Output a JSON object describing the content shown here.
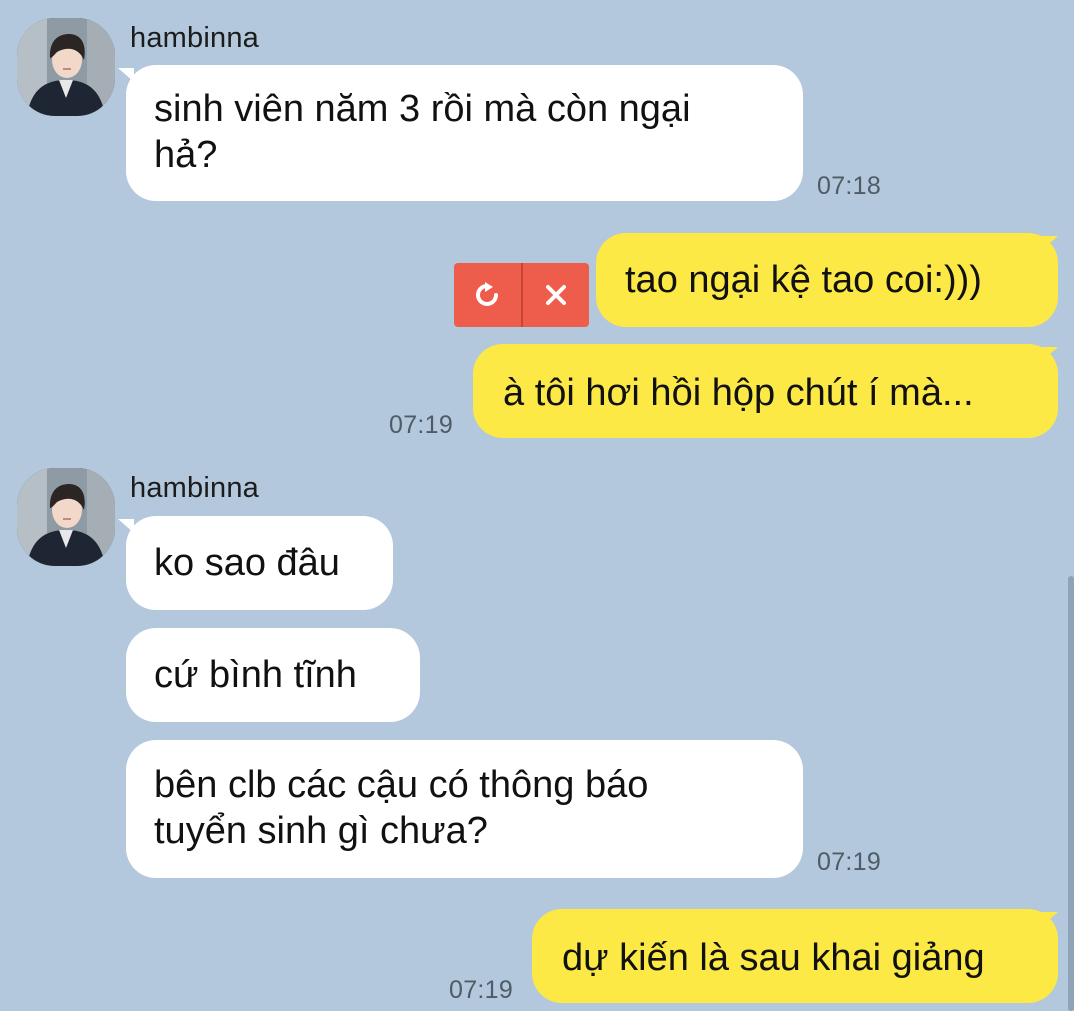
{
  "messages": [
    {
      "sender": "hambinna",
      "lines": [
        "sinh viên năm 3 rồi mà còn ngại",
        "hả?"
      ],
      "time": "07:18"
    },
    {
      "text": "tao ngại kệ tao coi:)))",
      "failed": true
    },
    {
      "text": "à tôi hơi hồi hộp chút í mà...",
      "time": "07:19"
    },
    {
      "sender": "hambinna",
      "items": [
        {
          "text": "ko sao đâu"
        },
        {
          "text": "cứ bình tĩnh"
        },
        {
          "lines": [
            "bên clb các cậu có thông báo",
            "tuyển sinh gì chưa?"
          ],
          "time": "07:19"
        }
      ]
    },
    {
      "text": "dự kiến là sau khai giảng",
      "time": "07:19"
    }
  ],
  "colors": {
    "background": "#b3c8dc",
    "incoming_bubble": "#ffffff",
    "outgoing_bubble": "#fde945",
    "fail_box": "#ee5c4b"
  },
  "icons": {
    "retry": "retry-icon",
    "delete": "close-icon"
  }
}
